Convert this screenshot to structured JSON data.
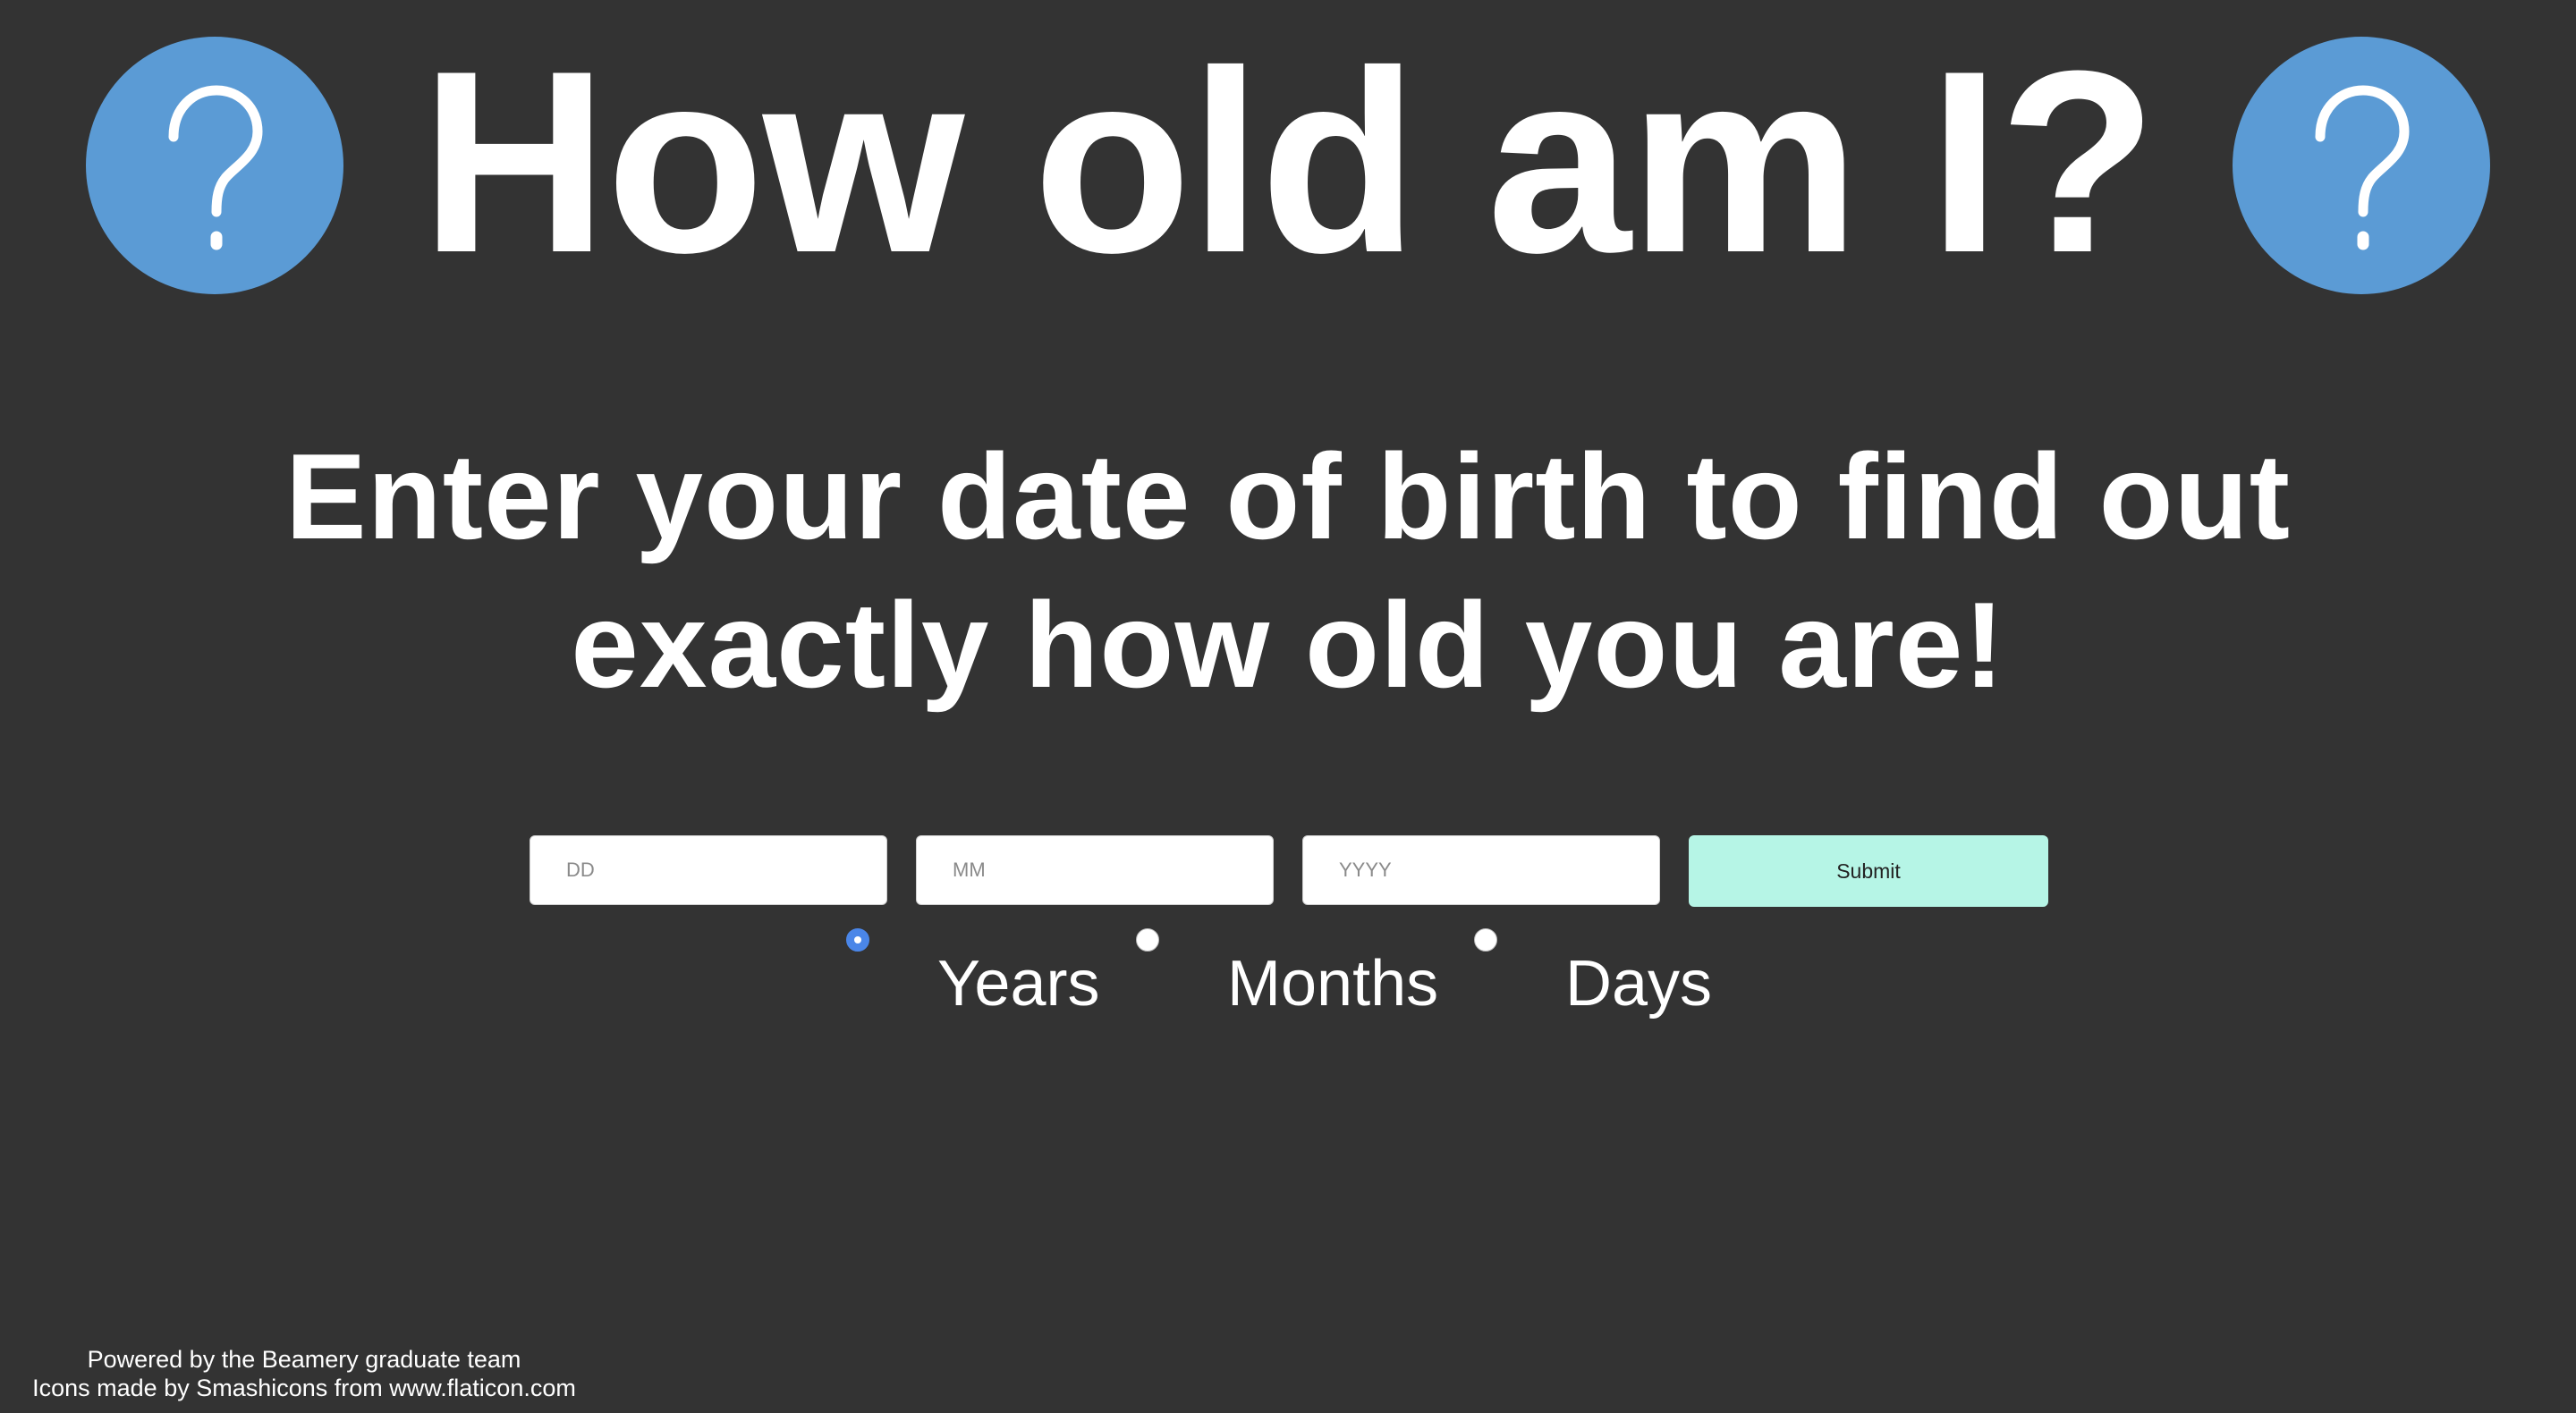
{
  "header": {
    "title": "How old am I?",
    "icon_left": "question-circle-icon",
    "icon_right": "question-circle-icon",
    "icon_color": "#5b9bd5"
  },
  "subtitle": {
    "line1": "Enter your date of birth to find out",
    "line2": "exactly how old you are!"
  },
  "form": {
    "day": {
      "placeholder": "DD",
      "value": ""
    },
    "month": {
      "placeholder": "MM",
      "value": ""
    },
    "year": {
      "placeholder": "YYYY",
      "value": ""
    },
    "submit_label": "Submit",
    "submit_color": "#b6f5e6"
  },
  "unit_options": {
    "selected": "Years",
    "items": [
      {
        "label": "Years",
        "checked": true
      },
      {
        "label": "Months",
        "checked": false
      },
      {
        "label": "Days",
        "checked": false
      }
    ]
  },
  "footer": {
    "line1": "Powered by the Beamery graduate team",
    "line2": "Icons made by Smashicons from www.flaticon.com"
  },
  "colors": {
    "background": "#333333",
    "text": "#ffffff",
    "radio_selected": "#4a86e8"
  }
}
